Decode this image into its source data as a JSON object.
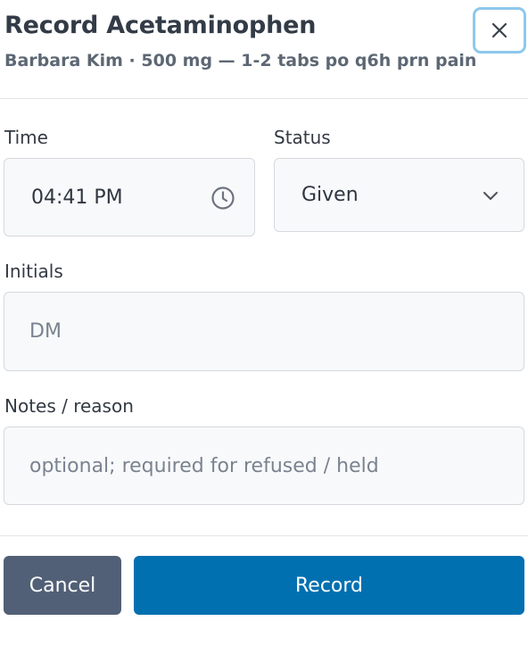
{
  "dialog": {
    "title": "Record Acetaminophen",
    "subtitle": "Barbara Kim · 500 mg — 1-2 tabs po q6h prn pain",
    "close_icon": "close-icon"
  },
  "form": {
    "time": {
      "label": "Time",
      "value": "04:41  PM",
      "icon": "clock-icon"
    },
    "status": {
      "label": "Status",
      "value": "Given",
      "icon": "chevron-down-icon"
    },
    "initials": {
      "label": "Initials",
      "placeholder": "DM"
    },
    "notes": {
      "label": "Notes / reason",
      "placeholder": "optional; required for refused / held"
    }
  },
  "actions": {
    "cancel_label": "Cancel",
    "record_label": "Record"
  },
  "colors": {
    "primary": "#0170b1",
    "secondary": "#516076",
    "focus_ring": "#8ec8ec"
  }
}
